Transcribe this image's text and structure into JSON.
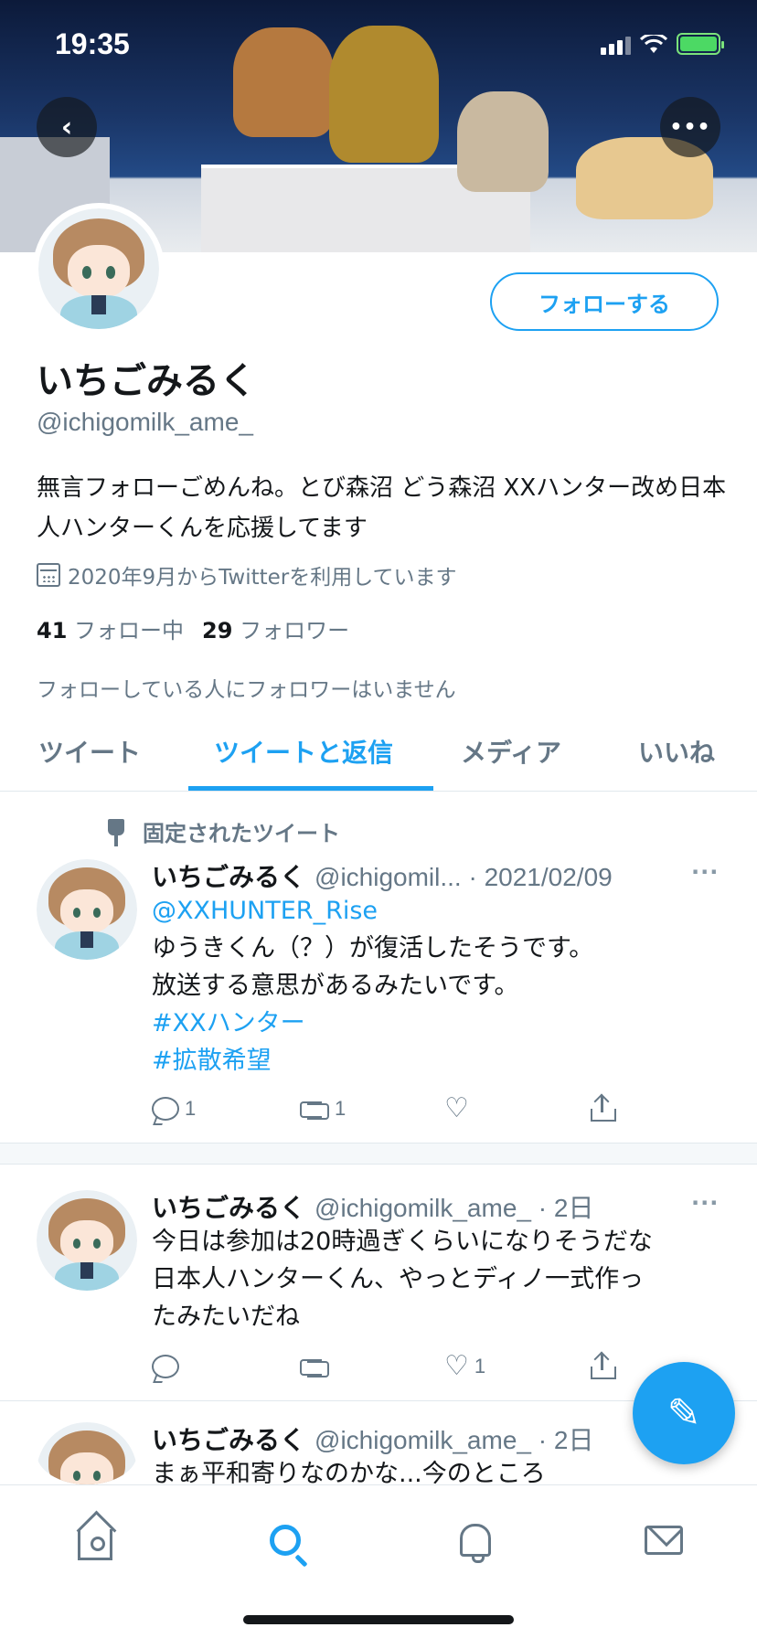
{
  "status_bar": {
    "time": "19:35"
  },
  "profile": {
    "display_name": "いちごみるく",
    "handle": "@ichigomilk_ame_",
    "bio": "無言フォローごめんね。とび森沼 どう森沼 XXハンター改め日本人ハンターくんを応援してます",
    "joined": "2020年9月からTwitterを利用しています",
    "following_count": "41",
    "following_label": "フォロー中",
    "followers_count": "29",
    "followers_label": "フォロワー",
    "no_common_followers": "フォローしている人にフォロワーはいません",
    "follow_button": "フォローする"
  },
  "tabs": [
    {
      "label": "ツイート"
    },
    {
      "label": "ツイートと返信"
    },
    {
      "label": "メディア"
    },
    {
      "label": "いいね"
    }
  ],
  "active_tab": "ツイートと返信",
  "tweets": [
    {
      "pinned_label": "固定されたツイート",
      "name": "いちごみるく",
      "handle": "@ichigomil...",
      "time": "· 2021/02/09",
      "more": "···",
      "mention": "@XXHUNTER_Rise",
      "line1": "ゆうきくん（？）が復活したそうです。",
      "line2": "放送する意思があるみたいです。",
      "hashtag1": "#XXハンター",
      "hashtag2": "#拡散希望",
      "reply_count": "1",
      "retweet_count": "1",
      "like_count": "",
      "share_count": ""
    },
    {
      "name": "いちごみるく",
      "handle": "@ichigomilk_ame_",
      "time": "· 2日",
      "more": "···",
      "line1": "今日は参加は20時過ぎくらいになりそうだな",
      "line2": "日本人ハンターくん、やっとディノ一式作っ",
      "line3": "たみたいだね",
      "reply_count": "",
      "retweet_count": "",
      "like_count": "1",
      "share_count": ""
    },
    {
      "name": "いちごみるく",
      "handle": "@ichigomilk_ame_",
      "time": "· 2日",
      "line1": "まぁ平和寄りなのかな...今のところ"
    }
  ],
  "colors": {
    "accent": "#1da1f2",
    "text": "#14171a",
    "muted": "#657786"
  },
  "icons": {
    "back": "chevron-left-icon",
    "more": "more-dots-icon",
    "compose": "compose-tweet-icon",
    "tabbar": [
      "home-icon",
      "search-icon",
      "bell-icon",
      "mail-icon"
    ]
  }
}
